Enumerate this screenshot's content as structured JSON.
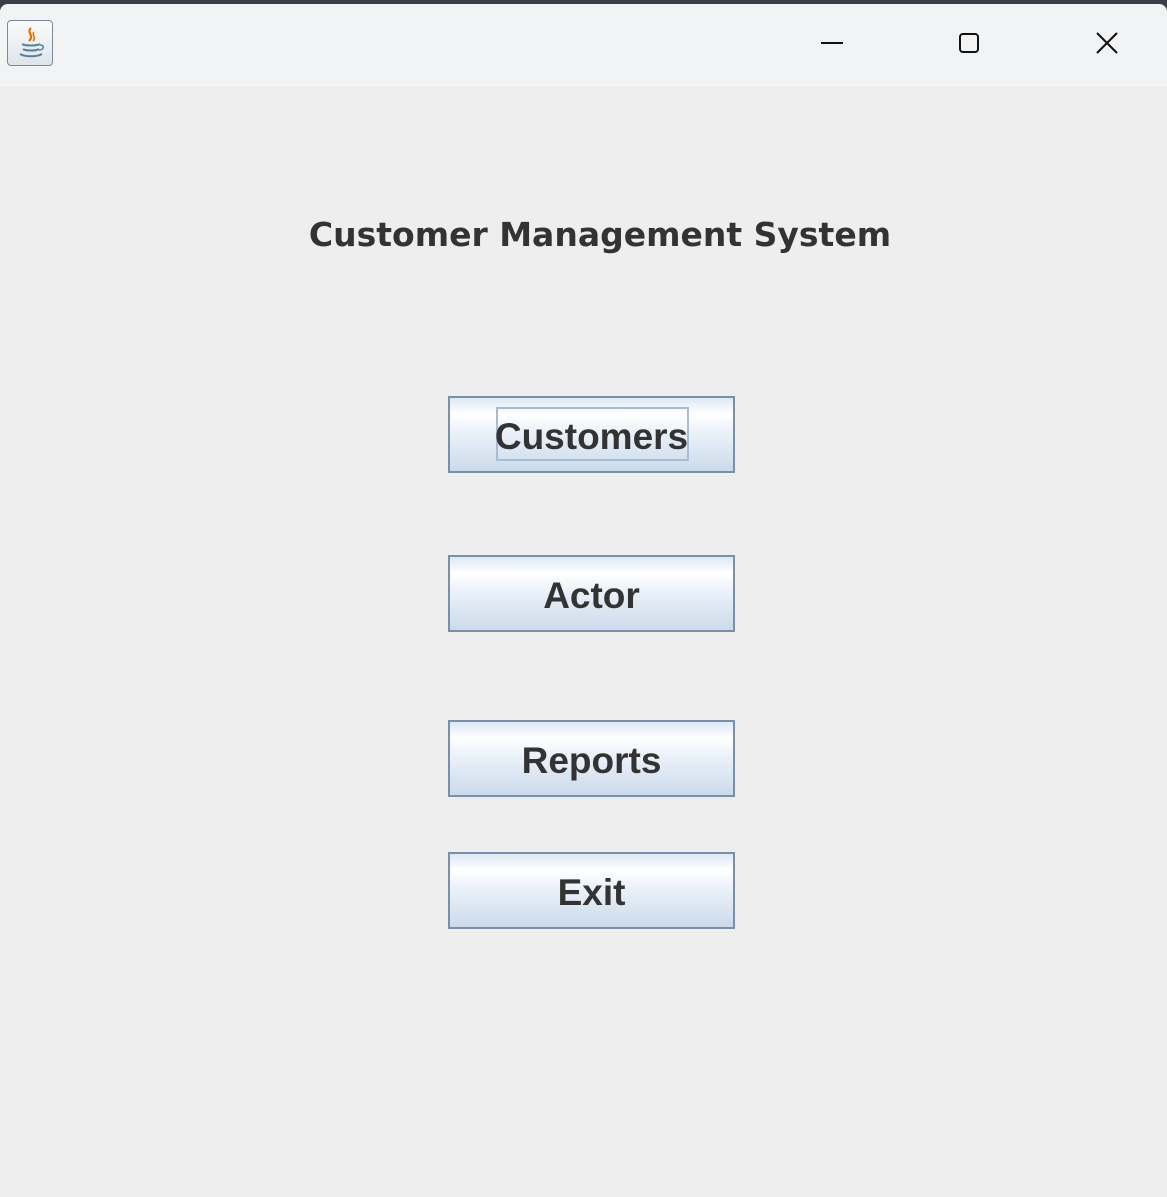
{
  "window": {
    "icon": "java-coffee-cup-icon",
    "controls": {
      "minimize": "minimize-icon",
      "maximize": "maximize-icon",
      "close": "close-icon"
    }
  },
  "main": {
    "heading": "Customer Management System",
    "buttons": [
      {
        "label": "Customers",
        "focused": true
      },
      {
        "label": "Actor"
      },
      {
        "label": "Reports"
      },
      {
        "label": "Exit"
      }
    ]
  },
  "colors": {
    "background": "#eeeeee",
    "titlebar": "#f2f3f5",
    "text": "#333333",
    "button_border": "#7a8fa8",
    "java_orange": "#e76f00",
    "java_blue": "#5382a1"
  }
}
